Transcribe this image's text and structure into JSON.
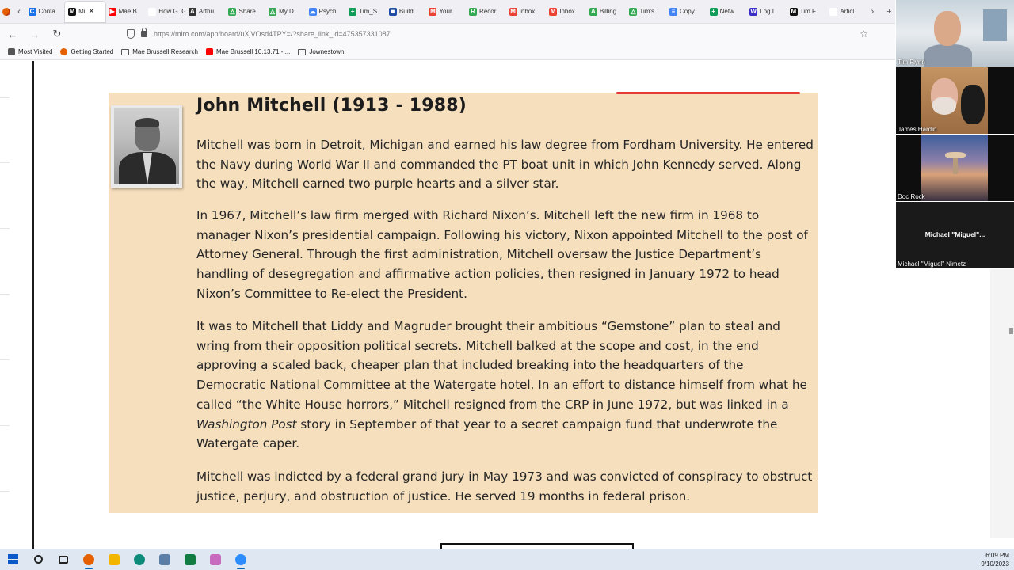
{
  "browser": {
    "tabs": [
      {
        "label": "Conta",
        "color": "#1a73e8",
        "glyph": "C"
      },
      {
        "label": "Mi",
        "color": "#111111",
        "glyph": "M",
        "active": true
      },
      {
        "label": "Mae B",
        "color": "#ff0000",
        "glyph": "▶"
      },
      {
        "label": "How G. G",
        "color": "#ffffff",
        "glyph": ""
      },
      {
        "label": "Arthu",
        "color": "#333333",
        "glyph": "A"
      },
      {
        "label": "Share",
        "color": "#34a853",
        "glyph": "△"
      },
      {
        "label": "My D",
        "color": "#34a853",
        "glyph": "△"
      },
      {
        "label": "Psych",
        "color": "#4285f4",
        "glyph": "☁"
      },
      {
        "label": "Tim_S",
        "color": "#0f9d58",
        "glyph": "+"
      },
      {
        "label": "Build",
        "color": "#1f4ea8",
        "glyph": "■"
      },
      {
        "label": "Your",
        "color": "#ea4335",
        "glyph": "M"
      },
      {
        "label": "Recor",
        "color": "#34a853",
        "glyph": "R"
      },
      {
        "label": "Inbox",
        "color": "#ea4335",
        "glyph": "M"
      },
      {
        "label": "Inbox",
        "color": "#ea4335",
        "glyph": "M"
      },
      {
        "label": "Billing",
        "color": "#34a853",
        "glyph": "A"
      },
      {
        "label": "Tim's",
        "color": "#34a853",
        "glyph": "△"
      },
      {
        "label": "Copy",
        "color": "#4285f4",
        "glyph": "≡"
      },
      {
        "label": "Netw",
        "color": "#0f9d58",
        "glyph": "+"
      },
      {
        "label": "Log I",
        "color": "#3b2fc9",
        "glyph": "W"
      },
      {
        "label": "Tim F",
        "color": "#111111",
        "glyph": "M"
      },
      {
        "label": "Articl",
        "color": "#ffffff",
        "glyph": ""
      }
    ],
    "close_glyph": "✕",
    "back_glyph": "‹",
    "forward_glyph": "›",
    "new_tab_glyph": "+",
    "url": "https://miro.com/app/board/uXjVOsd4TPY=/?share_link_id=475357331087",
    "bookmarks": [
      {
        "label": "Most Visited",
        "icon": "gear-icon",
        "color": "#555555"
      },
      {
        "label": "Getting Started",
        "icon": "firefox-icon",
        "color": "#e66000"
      },
      {
        "label": "Mae Brussell Research",
        "icon": "folder-icon",
        "color": ""
      },
      {
        "label": "Mae Brussell 10.13.71 - ...",
        "icon": "youtube-icon",
        "color": "#ff0000"
      },
      {
        "label": "Jownestown",
        "icon": "folder-icon",
        "color": ""
      }
    ]
  },
  "card": {
    "title": "John Mitchell (1913 - 1988)",
    "p1": "Mitchell was born in Detroit, Michigan and earned his law degree from Fordham University. He entered the Navy during World War II and commanded the PT boat unit in which John Kennedy served. Along the way, Mitchell earned two purple hearts and a silver star.",
    "p2": "In 1967, Mitchell’s law firm merged with Richard Nixon’s. Mitchell left the new firm in 1968 to manager Nixon’s presidential campaign. Following his victory, Nixon appointed Mitchell to the post of Attorney General. Through the first administration, Mitchell oversaw the Justice Department’s handling of desegregation and affirmative action policies, then resigned in January 1972 to head Nixon’s Committee to Re-elect the President.",
    "p3_before": "It was to Mitchell that Liddy and Magruder brought their ambitious “Gemstone” plan to steal and wring from their opposition political secrets. Mitchell balked at the scope and cost, in the end approving a scaled back, cheaper plan that included breaking into the headquarters of the Democratic National Committee at the Watergate hotel. In an effort to distance himself from what he called “the White House horrors,” Mitchell resigned from the CRP in June 1972, but was linked in a ",
    "p3_italic": "Washington Post",
    "p3_after": " story in September of that year to a secret campaign fund that underwrote the Watergate caper.",
    "p4": "Mitchell was indicted by a federal grand jury in May 1973 and was convicted of conspiracy to obstruct justice, perjury, and obstruction of justice. He served 19 months in federal prison."
  },
  "video_call": {
    "participants": [
      {
        "name": "Tim Flynn"
      },
      {
        "name": "James Hardin"
      },
      {
        "name": "Doc Rock"
      },
      {
        "name": "Michael \"Miguel\" Nimetz",
        "center_label": "Michael \"Miguel\"..."
      }
    ]
  },
  "taskbar": {
    "apps": [
      {
        "name": "start-button",
        "color": "#0a58ca"
      },
      {
        "name": "search-icon",
        "color": "#222222"
      },
      {
        "name": "task-view-icon",
        "color": "#222222"
      },
      {
        "name": "firefox-app-icon",
        "color": "#e66000",
        "active": true
      },
      {
        "name": "file-explorer-icon",
        "color": "#f2b600"
      },
      {
        "name": "edge-icon",
        "color": "#0c8a7a"
      },
      {
        "name": "app-icon",
        "color": "#5b7ea6"
      },
      {
        "name": "excel-icon",
        "color": "#107c41"
      },
      {
        "name": "paint-icon",
        "color": "#c86bbf"
      },
      {
        "name": "zoom-icon",
        "color": "#2d8cff",
        "active": true
      }
    ],
    "time": "6:09 PM",
    "date": "9/10/2023"
  }
}
